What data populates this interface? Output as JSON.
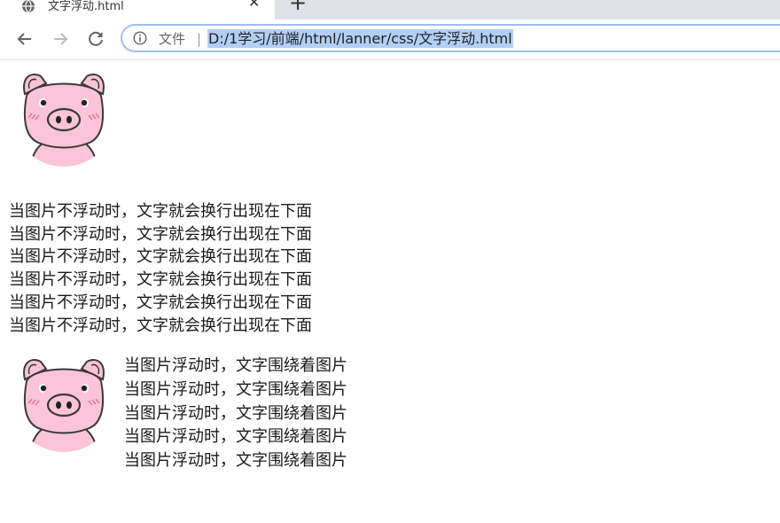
{
  "browser": {
    "tab": {
      "title": "文字浮动.html",
      "favicon": "globe-icon",
      "close_icon": "close-icon",
      "new_tab_icon": "plus-icon"
    },
    "toolbar": {
      "back_icon": "arrow-left-icon",
      "forward_icon": "arrow-right-icon",
      "reload_icon": "reload-icon",
      "info_icon": "info-icon",
      "scheme_label": "文件",
      "divider": "|",
      "url": "D:/1学习/前端/html/lanner/css/文字浮动.html"
    }
  },
  "page": {
    "non_float_lines": [
      "当图片不浮动时，文字就会换行出现在下面",
      "当图片不浮动时，文字就会换行出现在下面",
      "当图片不浮动时，文字就会换行出现在下面",
      "当图片不浮动时，文字就会换行出现在下面",
      "当图片不浮动时，文字就会换行出现在下面",
      "当图片不浮动时，文字就会换行出现在下面"
    ],
    "float_text": "当图片浮动时，文字围绕着图片 当图片浮动时，文字围绕着图片 当图片浮动时，文字围绕着图片 当图片浮动时，文字围绕着图片 当图片浮动时，文字围绕着图片",
    "image_icon": "pig-icon"
  },
  "colors": {
    "pig_pink": "#fbc4d8",
    "pig_outline": "#3a3a3a",
    "url_highlight": "#b3cff5",
    "tab_strip": "#dee1e6"
  }
}
